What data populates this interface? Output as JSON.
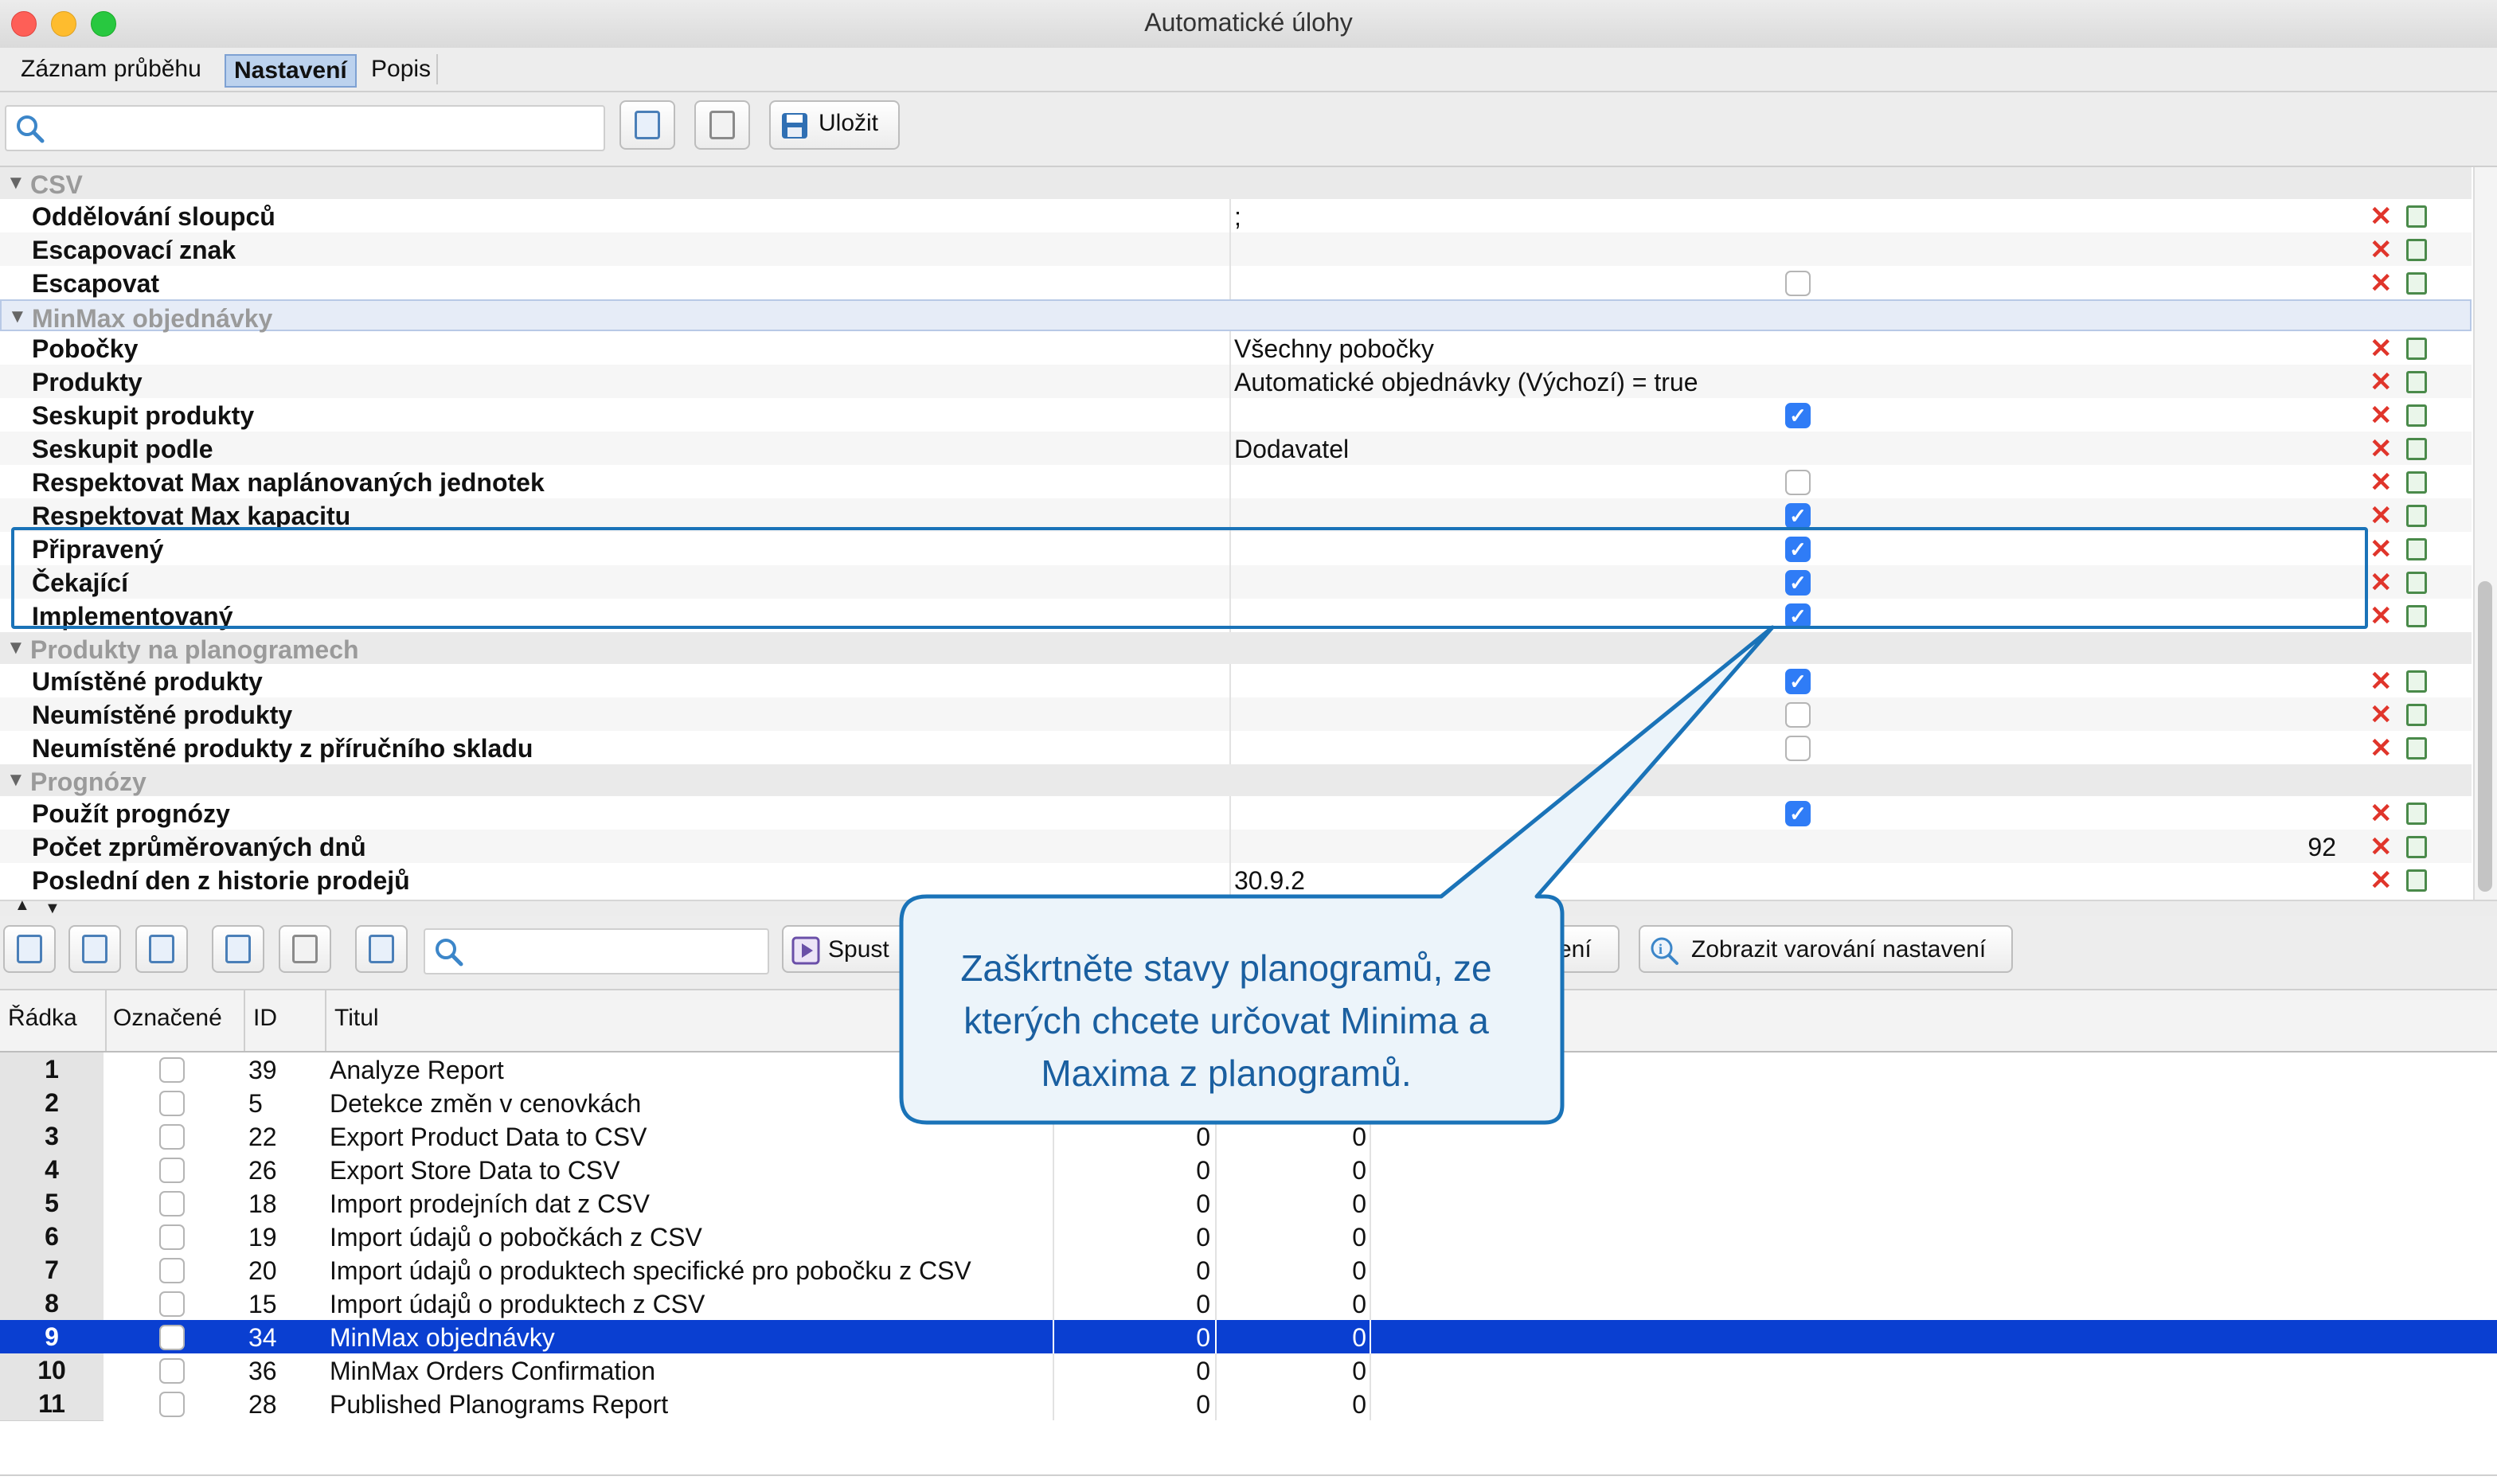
{
  "window": {
    "title": "Automatické úlohy"
  },
  "tabs": [
    {
      "label": "Záznam průběhu"
    },
    {
      "label": "Nastavení"
    },
    {
      "label": "Popis"
    }
  ],
  "toolbar": {
    "save_label": "Uložit",
    "search_placeholder": ""
  },
  "properties": {
    "csv": {
      "label": "CSV",
      "rows": [
        {
          "label": "Oddělování sloupců",
          "value": ";"
        },
        {
          "label": "Escapovací znak",
          "value": ""
        },
        {
          "label": "Escapovat",
          "checked": false
        }
      ]
    },
    "minmax": {
      "label": "MinMax objednávky",
      "rows": [
        {
          "label": "Pobočky",
          "value": "Všechny pobočky"
        },
        {
          "label": "Produkty",
          "value": "Automatické objednávky (Výchozí) = true"
        },
        {
          "label": "Seskupit produkty",
          "checked": true
        },
        {
          "label": "Seskupit podle",
          "value": "Dodavatel"
        },
        {
          "label": "Respektovat Max naplánovaných jednotek",
          "checked": false
        },
        {
          "label": "Respektovat Max kapacitu",
          "checked": true
        },
        {
          "label": "Připravený",
          "checked": true
        },
        {
          "label": "Čekající",
          "checked": true
        },
        {
          "label": "Implementovaný",
          "checked": true
        }
      ]
    },
    "planogram": {
      "label": "Produkty na planogramech",
      "rows": [
        {
          "label": "Umístěné produkty",
          "checked": true
        },
        {
          "label": "Neumístěné produkty",
          "checked": false
        },
        {
          "label": "Neumístěné produkty z příručního skladu",
          "checked": false
        }
      ]
    },
    "forecast": {
      "label": "Prognózy",
      "rows": [
        {
          "label": "Použít prognózy",
          "checked": true
        },
        {
          "label": "Počet zprůměrovaných dnů",
          "value": "92"
        },
        {
          "label": "Poslední den z historie prodejů",
          "value": "30.9.2"
        }
      ]
    }
  },
  "lower_toolbar": {
    "run_label": "Spust",
    "settings_partial_label": "vení",
    "warnings_label": "Zobrazit varování nastavení"
  },
  "table": {
    "headers": {
      "row": "Řádka",
      "marked": "Označené",
      "id": "ID",
      "title": "Titul"
    },
    "rows": [
      {
        "n": "1",
        "id": "39",
        "title": "Analyze Report",
        "v1": "",
        "v2": ""
      },
      {
        "n": "2",
        "id": "5",
        "title": "Detekce změn v cenovkách",
        "v1": "",
        "v2": ""
      },
      {
        "n": "3",
        "id": "22",
        "title": "Export Product Data to CSV",
        "v1": "0",
        "v2": "0"
      },
      {
        "n": "4",
        "id": "26",
        "title": "Export Store Data to CSV",
        "v1": "0",
        "v2": "0"
      },
      {
        "n": "5",
        "id": "18",
        "title": "Import prodejních dat z CSV",
        "v1": "0",
        "v2": "0"
      },
      {
        "n": "6",
        "id": "19",
        "title": "Import údajů o pobočkách z CSV",
        "v1": "0",
        "v2": "0"
      },
      {
        "n": "7",
        "id": "20",
        "title": "Import údajů o produktech specifické pro pobočku z CSV",
        "v1": "0",
        "v2": "0"
      },
      {
        "n": "8",
        "id": "15",
        "title": "Import údajů o produktech z CSV",
        "v1": "0",
        "v2": "0"
      },
      {
        "n": "9",
        "id": "34",
        "title": "MinMax objednávky",
        "v1": "0",
        "v2": "0"
      },
      {
        "n": "10",
        "id": "36",
        "title": "MinMax Orders Confirmation",
        "v1": "0",
        "v2": "0"
      },
      {
        "n": "11",
        "id": "28",
        "title": "Published Planograms Report",
        "v1": "0",
        "v2": "0"
      }
    ]
  },
  "callout": {
    "text": "Zaškrtněte stavy planogramů, ze kterých chcete určovat Minima a Maxima z planogramů."
  },
  "colors": {
    "accent": "#2f7cf6",
    "selection": "#0a3fd1",
    "callout_border": "#1a73b8"
  }
}
